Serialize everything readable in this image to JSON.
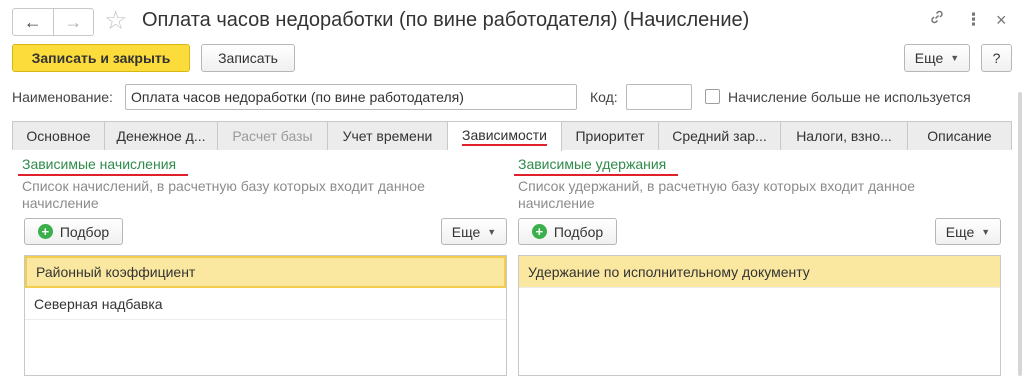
{
  "window": {
    "title": "Оплата часов недоработки (по вине работодателя) (Начисление)",
    "nav_back": "←",
    "nav_forward": "→",
    "favorite": "☆",
    "link": "🔗",
    "more": "⋮",
    "close": "×"
  },
  "toolbar": {
    "save_close_label": "Записать и закрыть",
    "save_label": "Записать",
    "more_label": "Еще",
    "help_label": "?"
  },
  "form": {
    "name_label": "Наименование:",
    "name_value": "Оплата часов недоработки (по вине работодателя)",
    "code_label": "Код:",
    "code_value": "",
    "unused_label": "Начисление больше не используется",
    "unused_checked": false
  },
  "tabs": [
    {
      "label": "Основное",
      "state": "normal"
    },
    {
      "label": "Денежное д...",
      "state": "normal"
    },
    {
      "label": "Расчет базы",
      "state": "disabled"
    },
    {
      "label": "Учет времени",
      "state": "normal"
    },
    {
      "label": "Зависимости",
      "state": "active"
    },
    {
      "label": "Приоритет",
      "state": "normal"
    },
    {
      "label": "Средний зар...",
      "state": "normal"
    },
    {
      "label": "Налоги, взно...",
      "state": "normal"
    },
    {
      "label": "Описание",
      "state": "normal"
    }
  ],
  "left_panel": {
    "title": "Зависимые начисления",
    "hint": "Список начислений, в расчетную базу которых входит данное начисление",
    "pick_label": "Подбор",
    "more_label": "Еще",
    "rows": [
      "Районный коэффициент",
      "Северная надбавка"
    ]
  },
  "right_panel": {
    "title": "Зависимые удержания",
    "hint": "Список удержаний, в расчетную базу которых входит данное начисление",
    "pick_label": "Подбор",
    "more_label": "Еще",
    "rows": [
      "Удержание по исполнительному документу"
    ]
  },
  "colors": {
    "primary_button": "#fcdc3a",
    "section_title": "#2e8b4a",
    "accent_red": "#e0202a",
    "selection": "#fbe8a0",
    "add_icon": "#3bb04a"
  }
}
